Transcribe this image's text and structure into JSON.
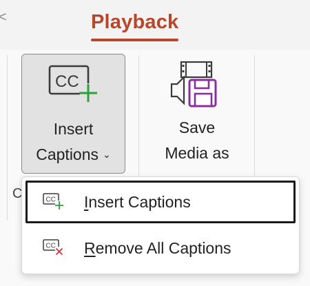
{
  "ribbon": {
    "active_tab": "Playback",
    "collapsed_tab_hint": "<",
    "clipped_group_label": "C"
  },
  "insert_captions_button": {
    "line1": "Insert",
    "line2": "Captions",
    "chevron": "⌄",
    "icon": "closed-captions-add-icon",
    "state": "pressed"
  },
  "save_media_button": {
    "line1": "Save",
    "line2": "Media as",
    "icon": "save-media-icon"
  },
  "dropdown_menu": {
    "items": [
      {
        "accel": "I",
        "rest": "nsert Captions",
        "icon": "closed-captions-add-icon",
        "focused": true
      },
      {
        "accel": "R",
        "rest": "emove All Captions",
        "icon": "closed-captions-remove-icon",
        "focused": false
      }
    ]
  },
  "colors": {
    "accent": "#b7472a",
    "add_green": "#2e9f3e",
    "remove_red": "#d13438",
    "purple": "#8a2d9e"
  }
}
